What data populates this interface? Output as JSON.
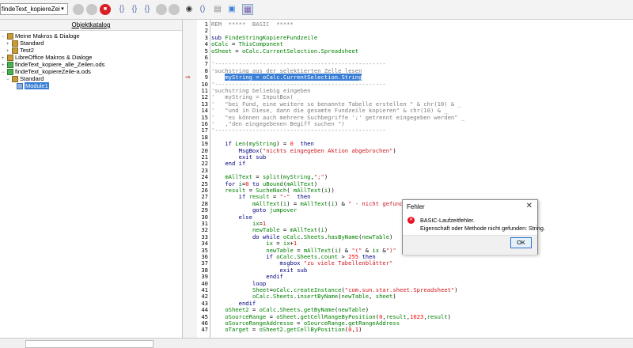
{
  "toolbar": {
    "library_combo": "findeText_kopiereZeile-a.ods",
    "icons": [
      "compile-icon",
      "run-icon",
      "stop-icon",
      "step-into-icon",
      "step-over-icon",
      "step-out-icon",
      "breakpoint-icon",
      "manage-breakpoints-icon",
      "watch-icon",
      "find-parentheses-icon",
      "insert-basic-source-icon",
      "save-basic-icon",
      "import-dialog-icon"
    ]
  },
  "left_panel": {
    "title": "Objektkatalog",
    "tree": [
      {
        "label": "Meine Makros & Dialoge",
        "level": 0
      },
      {
        "label": "Standard",
        "level": 1
      },
      {
        "label": "Test2",
        "level": 1
      },
      {
        "label": "LibreOffice Makros & Dialoge",
        "level": 0
      },
      {
        "label": "findeText_kopiere_alle_Zeilen.ods",
        "level": 0
      },
      {
        "label": "findeText_kopiereZeile-a.ods",
        "level": 0
      },
      {
        "label": "Standard",
        "level": 1
      },
      {
        "label": "Module1",
        "level": 2
      }
    ]
  },
  "editor": {
    "current_line": 9,
    "lines": [
      "REM  *****  BASIC  *****",
      "",
      "sub FindeStringKopiereFundzeile",
      "oCalc = ThisComponent",
      "oSheet = oCalc.CurrentSelection.Spreadsheet",
      "",
      "'--------------------------------------------------",
      "'suchstring aus der selektierten Zelle lesen",
      "    myString = oCalc.CurrentSelection.String",
      "'--------------------------------------------------",
      "'suchstring beliebig eingeben",
      "'   myString = InputBox( _",
      "'   \"bei Fund, eine weitere so benannte Tabelle erstellen \" & chr(10) & _",
      "'   \"und in Diese, dann die gesamte Fundzeile kopieren\" & chr(10) & _",
      "'   \"es können auch mehrere Suchbegriffe ';' getrennt eingegeben werden\" _",
      "'   ,\"den eingegebenen Begiff suchen \")",
      "'--------------------------------------------------",
      "",
      "    if Len(myString) = 0  then",
      "        MsgBox(\"nichts eingegeben Aktion abgebrochen\")",
      "        exit sub",
      "    end if",
      "",
      "    mAllText = split(myString,\";\")",
      "    for i=0 to uBound(mAllText)",
      "    result = SucheNach( mAllText(i))",
      "        if result = \"-\"  then",
      "            mAllText(i) = mAllText(i) & \" - nicht gefunden\"",
      "            goto jumpover",
      "        else",
      "            ix=1",
      "            newTable = mAllText(i)",
      "            do while oCalc.Sheets.hasByName(newTable)",
      "                ix = ix+1",
      "                newTable = mAllText(i) & \"(\" & ix &\")\"",
      "                if oCalc.Sheets.count > 255 then",
      "                    msgbox \"zu viele Tabellenblätter\"",
      "                    exit sub",
      "                endif",
      "            loop",
      "            Sheet=oCalc.createInstance(\"com.sun.star.sheet.Spreadsheet\")",
      "            oCalc.Sheets.insertByName(newTable, sheet)",
      "        endif",
      "    oSheet2 = oCalc.Sheets.getByName(newTable)",
      "    oSourceRange = oSheet.getCellRangeByPosition(0,result,1023,result)",
      "    oSourceRangeAddresse = oSourceRange.getRangeAddress",
      "    oTarget = oSheet2.getCellByPosition(0,1)"
    ]
  },
  "dialog": {
    "title": "Fehler",
    "close": "✕",
    "line1": "BASIC-Laufzeitfehler.",
    "line2": "Eigenschaft oder Methode nicht gefunden: String.",
    "ok_label": "OK"
  },
  "colors": {
    "comment": "#7f7f7f",
    "keyword": "#000080",
    "identifier": "#008000",
    "string": "#ce181e",
    "number": "#ff0000",
    "selection": "#3a7fd5"
  }
}
